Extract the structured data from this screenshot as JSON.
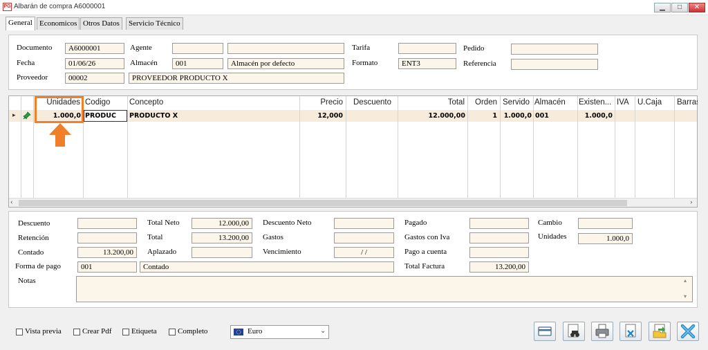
{
  "window": {
    "app_icon_text": "PG",
    "title": "Albarán de compra A6000001",
    "minimize": "▁",
    "maximize": "□",
    "close": "✕"
  },
  "tabs": [
    {
      "label": "General"
    },
    {
      "label": "Economicos"
    },
    {
      "label": "Otros Datos"
    },
    {
      "label": "Servicio Técnico"
    }
  ],
  "header": {
    "documento_label": "Documento",
    "documento": "A6000001",
    "fecha_label": "Fecha",
    "fecha": "01/06/26",
    "proveedor_label": "Proveedor",
    "proveedor_code": "00002",
    "proveedor_name": "PROVEEDOR PRODUCTO X",
    "agente_label": "Agente",
    "agente_code": "",
    "agente_name": "",
    "almacen_label": "Almacén",
    "almacen_code": "001",
    "almacen_name": "Almacén por defecto",
    "tarifa_label": "Tarifa",
    "tarifa": "",
    "formato_label": "Formato",
    "formato": "ENT3",
    "pedido_label": "Pedido",
    "pedido": "",
    "referencia_label": "Referencia",
    "referencia": ""
  },
  "grid": {
    "columns": [
      "Unidades",
      "Codigo",
      "Concepto",
      "Precio",
      "Descuento",
      "Total",
      "Orden",
      "Servido",
      "Almacén",
      "Existen...",
      "IVA",
      "U.Caja",
      "Barras"
    ],
    "rows": [
      {
        "unidades": "1.000,0",
        "codigo": "PRODUC",
        "concepto": "PRODUCTO X",
        "precio": "12,000",
        "descuento": "",
        "total": "12.000,00",
        "orden": "1",
        "servido": "1.000,0",
        "almacen": "001",
        "existencias": "1.000,0",
        "iva": "",
        "ucaja": "",
        "barras": ""
      }
    ],
    "row_marker": "▸",
    "scroll_left": "‹",
    "scroll_right": "›"
  },
  "totals": {
    "descuento_label": "Descuento",
    "descuento": "",
    "retencion_label": "Retención",
    "retencion": "",
    "contado_label": "Contado",
    "contado": "13.200,00",
    "forma_pago_label": "Forma de pago",
    "forma_pago_code": "001",
    "forma_pago_name": "Contado",
    "notas_label": "Notas",
    "notas": "",
    "total_neto_label": "Total Neto",
    "total_neto": "12.000,00",
    "total_label": "Total",
    "total": "13.200,00",
    "aplazado_label": "Aplazado",
    "aplazado": "",
    "descuento_neto_label": "Descuento Neto",
    "descuento_neto": "",
    "gastos_label": "Gastos",
    "gastos": "",
    "vencimiento_label": "Vencimiento",
    "vencimiento": " /  /",
    "pagado_label": "Pagado",
    "pagado": "",
    "gastos_iva_label": "Gastos con Iva",
    "gastos_iva": "",
    "pago_cuenta_label": "Pago a cuenta",
    "pago_cuenta": "",
    "total_factura_label": "Total Factura",
    "total_factura": "13.200,00",
    "cambio_label": "Cambio",
    "cambio": "",
    "unidades_label": "Unidades",
    "unidades": "1.000,0"
  },
  "footer": {
    "vista_previa": "Vista previa",
    "crear_pdf": "Crear Pdf",
    "etiqueta": "Etiqueta",
    "completo": "Completo",
    "currency": "Euro"
  },
  "colors": {
    "highlight": "#f07f2a",
    "field_bg": "#fbf5ea",
    "row_bg": "#f7ecdc"
  }
}
